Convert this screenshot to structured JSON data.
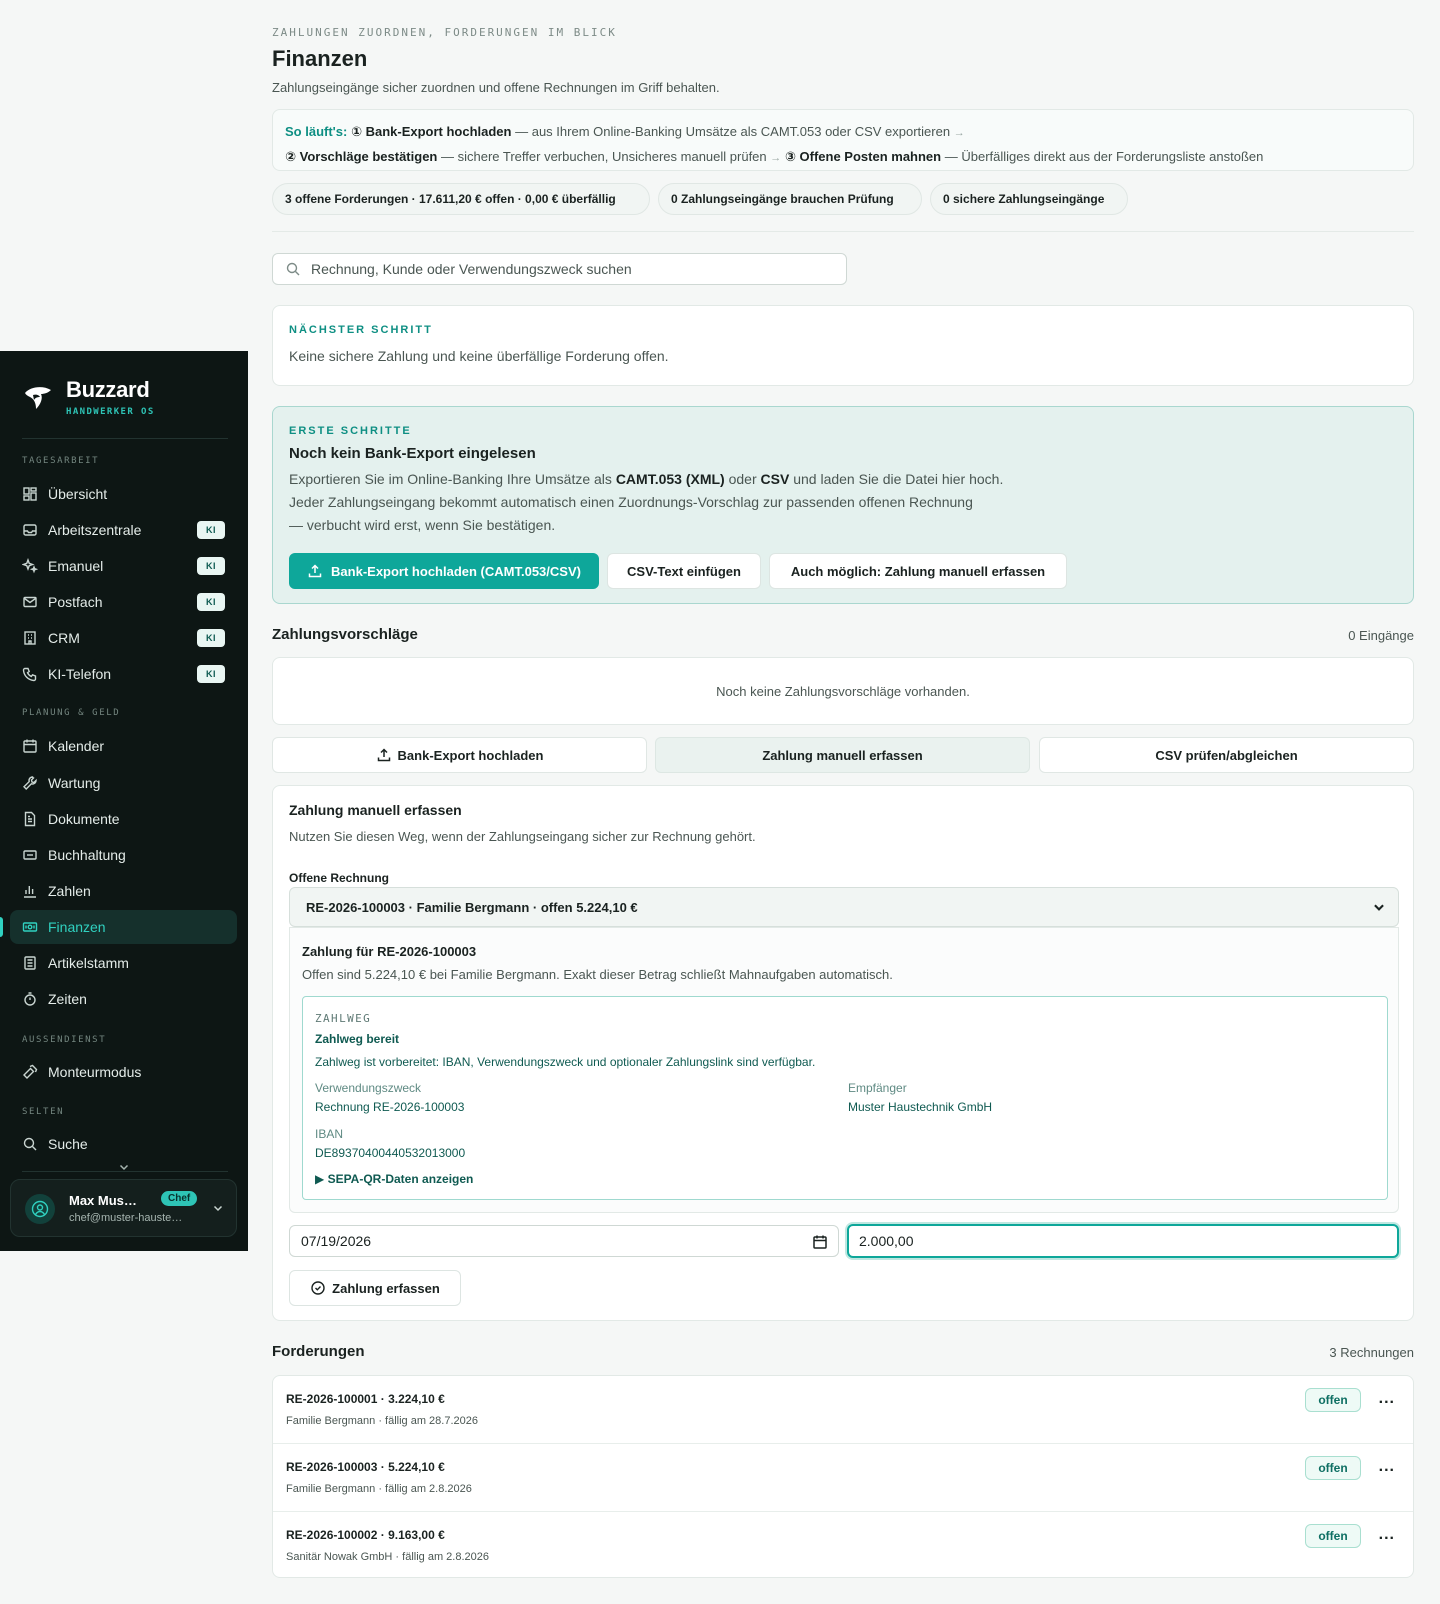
{
  "sidebar": {
    "brand": {
      "name": "Buzzard",
      "sub": "HANDWERKER OS"
    },
    "sections": {
      "tagesarbeit": "TAGESARBEIT",
      "planung": "PLANUNG & GELD",
      "aussendienst": "AUSSENDIENST",
      "selten": "SELTEN"
    },
    "ki_badge": "KI",
    "items": {
      "uebersicht": "Übersicht",
      "arbeitszentrale": "Arbeitszentrale",
      "emanuel": "Emanuel",
      "postfach": "Postfach",
      "crm": "CRM",
      "ki_telefon": "KI-Telefon",
      "kalender": "Kalender",
      "wartung": "Wartung",
      "dokumente": "Dokumente",
      "buchhaltung": "Buchhaltung",
      "zahlen": "Zahlen",
      "finanzen": "Finanzen",
      "artikelstamm": "Artikelstamm",
      "zeiten": "Zeiten",
      "monteurmodus": "Monteurmodus",
      "suche": "Suche"
    },
    "user": {
      "name": "Max Mus…",
      "role": "Chef",
      "email": "chef@muster-hauste…"
    }
  },
  "header": {
    "eyebrow": "ZAHLUNGEN ZUORDNEN, FORDERUNGEN IM BLICK",
    "title": "Finanzen",
    "subtitle": "Zahlungseingänge sicher zuordnen und offene Rechnungen im Griff behalten."
  },
  "howto": {
    "lead": "So läuft's:",
    "step1_title": "① Bank-Export hochladen",
    "step1_text": "— aus Ihrem Online-Banking Umsätze als CAMT.053 oder CSV exportieren",
    "step2_title": "② Vorschläge bestätigen",
    "step2_text": "— sichere Treffer verbuchen, Unsicheres manuell prüfen",
    "step3_title": "③ Offene Posten mahnen",
    "step3_text": "— Überfälliges direkt aus der Forderungsliste anstoßen",
    "arrow": "→"
  },
  "chips": {
    "forderungen": "3 offene Forderungen · 17.611,20 € offen · 0,00 € überfällig",
    "pruefung": "0 Zahlungseingänge brauchen Prüfung",
    "sicher": "0 sichere Zahlungseingänge"
  },
  "search": {
    "placeholder": "Rechnung, Kunde oder Verwendungszweck suchen"
  },
  "next_step": {
    "kicker": "NÄCHSTER SCHRITT",
    "text": "Keine sichere Zahlung und keine überfällige Forderung offen."
  },
  "first_steps": {
    "kicker": "ERSTE SCHRITTE",
    "title": "Noch kein Bank-Export eingelesen",
    "p_a": "Exportieren Sie im Online-Banking Ihre Umsätze als ",
    "p_b": "CAMT.053 (XML)",
    "p_c": " oder ",
    "p_d": "CSV",
    "p_e": " und laden Sie die Datei hier hoch.",
    "p_line2": "Jeder Zahlungseingang bekommt automatisch einen Zuordnungs-Vorschlag zur passenden offenen Rechnung",
    "p_line3": "— verbucht wird erst, wenn Sie bestätigen.",
    "btn_upload": "Bank-Export hochladen (CAMT.053/CSV)",
    "btn_csv": "CSV-Text einfügen",
    "btn_manual": "Auch möglich: Zahlung manuell erfassen"
  },
  "suggestions": {
    "title": "Zahlungsvorschläge",
    "count": "0 Eingänge",
    "empty": "Noch keine Zahlungsvorschläge vorhanden."
  },
  "tabs": {
    "upload": "Bank-Export hochladen",
    "manual": "Zahlung manuell erfassen",
    "csv": "CSV prüfen/abgleichen"
  },
  "manual": {
    "title": "Zahlung manuell erfassen",
    "desc": "Nutzen Sie diesen Weg, wenn der Zahlungseingang sicher zur Rechnung gehört.",
    "invoice_label": "Offene Rechnung",
    "invoice_selected": "RE-2026-100003 · Familie Bergmann · offen 5.224,10 €",
    "payment_for": "Zahlung für RE-2026-100003",
    "open_text": "Offen sind 5.224,10 € bei Familie Bergmann. Exakt dieser Betrag schließt Mahnaufgaben automatisch.",
    "zahlweg": {
      "kicker": "ZAHLWEG",
      "title": "Zahlweg bereit",
      "desc": "Zahlweg ist vorbereitet: IBAN, Verwendungszweck und optionaler Zahlungslink sind verfügbar.",
      "purpose_label": "Verwendungszweck",
      "purpose_value": "Rechnung RE-2026-100003",
      "recipient_label": "Empfänger",
      "recipient_value": "Muster Haustechnik GmbH",
      "iban_label": "IBAN",
      "iban_value": "DE89370400440532013000",
      "sepa_toggle": "▶ SEPA-QR-Daten anzeigen"
    },
    "date_value": "07/19/2026",
    "amount_value": "2.000,00",
    "submit": "Zahlung erfassen"
  },
  "claims": {
    "title": "Forderungen",
    "count": "3 Rechnungen",
    "items": [
      {
        "title": "RE-2026-100001 · 3.224,10 €",
        "meta": "Familie Bergmann · fällig am 28.7.2026",
        "status": "offen"
      },
      {
        "title": "RE-2026-100003 · 5.224,10 €",
        "meta": "Familie Bergmann · fällig am 2.8.2026",
        "status": "offen"
      },
      {
        "title": "RE-2026-100002 · 9.163,00 €",
        "meta": "Sanitär Nowak GmbH · fällig am 2.8.2026",
        "status": "offen"
      }
    ],
    "more": "..."
  },
  "colors": {
    "accent": "#0ea79a",
    "sidebar_bg": "#0d1614",
    "active": "#30d1c0"
  }
}
